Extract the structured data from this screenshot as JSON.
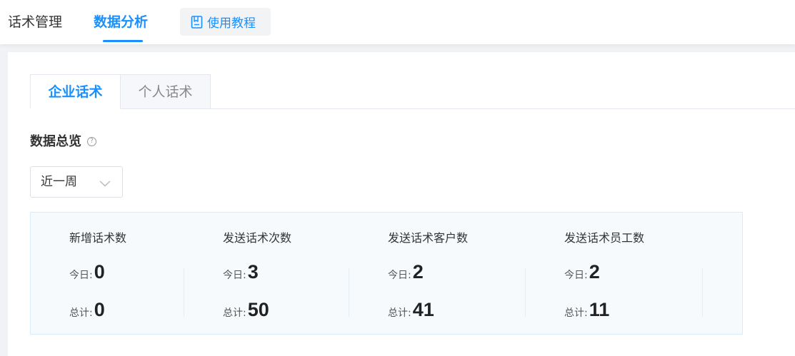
{
  "topnav": {
    "items": [
      {
        "label": "话术管理"
      },
      {
        "label": "数据分析"
      }
    ],
    "tutorial_label": "使用教程"
  },
  "tabs": [
    {
      "label": "企业话术"
    },
    {
      "label": "个人话术"
    }
  ],
  "section": {
    "title": "数据总览",
    "help_glyph": "?"
  },
  "period_select": {
    "value": "近一周"
  },
  "stats": {
    "today_label": "今日:",
    "total_label": "总计:",
    "columns": [
      {
        "title": "新增话术数",
        "today": "0",
        "total": "0"
      },
      {
        "title": "发送话术次数",
        "today": "3",
        "total": "50"
      },
      {
        "title": "发送话术客户数",
        "today": "2",
        "total": "41"
      },
      {
        "title": "发送话术员工数",
        "today": "2",
        "total": "11"
      }
    ]
  },
  "colors": {
    "accent": "#1890ff",
    "panel_bg": "#f6fafd"
  }
}
